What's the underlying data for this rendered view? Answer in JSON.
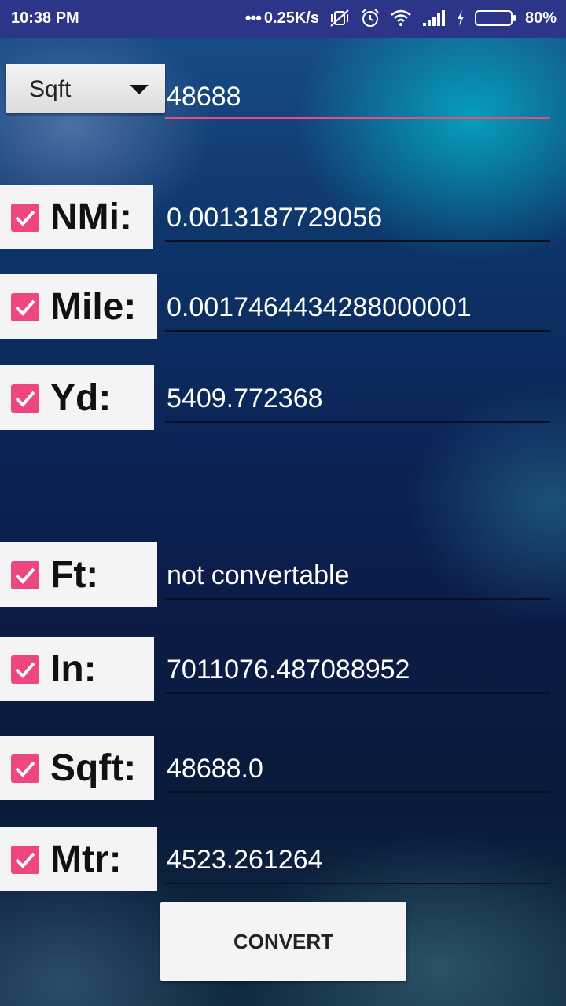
{
  "status_bar": {
    "time": "10:38 PM",
    "network_speed": "0.25K/s",
    "battery_percent": "80%",
    "battery_level": 0.8,
    "icons": [
      "mute-vibrate-icon",
      "alarm-icon",
      "wifi-icon",
      "signal-icon",
      "charging-icon",
      "battery-icon"
    ]
  },
  "unit_selector": {
    "selected": "Sqft",
    "icon": "dropdown-caret-icon"
  },
  "input": {
    "value": "48688"
  },
  "rows": [
    {
      "label": "NMi:",
      "checked": true,
      "value": "0.0013187729056"
    },
    {
      "label": "Mile:",
      "checked": true,
      "value": "0.0017464434288000001"
    },
    {
      "label": "Yd:",
      "checked": true,
      "value": "5409.772368"
    },
    {
      "label": "Ft:",
      "checked": true,
      "value": "not convertable"
    },
    {
      "label": "In:",
      "checked": true,
      "value": "7011076.487088952"
    },
    {
      "label": "Sqft:",
      "checked": true,
      "value": "48688.0"
    },
    {
      "label": "Mtr:",
      "checked": true,
      "value": "4523.261264"
    }
  ],
  "convert_button": {
    "label": "CONVERT"
  },
  "colors": {
    "accent": "#ee4780",
    "status_bar": "#2d3589",
    "checkbox": "#ee4780"
  }
}
